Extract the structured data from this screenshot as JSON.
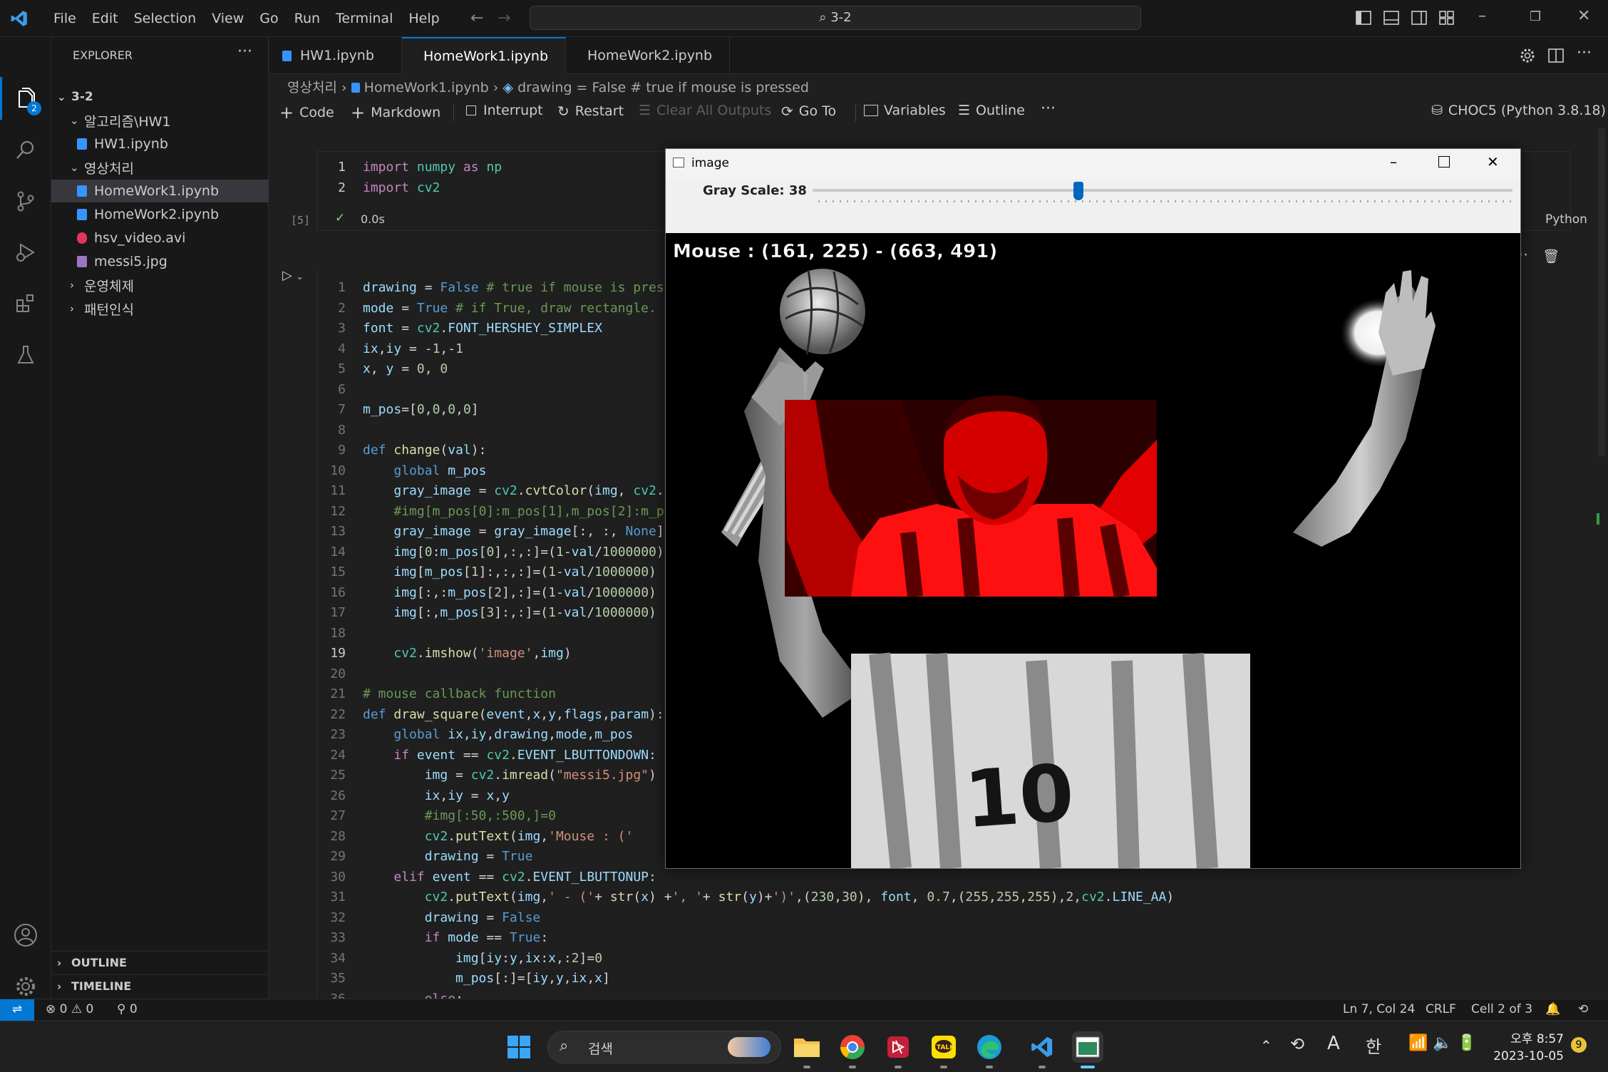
{
  "menu": [
    "File",
    "Edit",
    "Selection",
    "View",
    "Go",
    "Run",
    "Terminal",
    "Help"
  ],
  "search": {
    "text": "3-2"
  },
  "activity_badge": "2",
  "explorer": {
    "title": "EXPLORER",
    "root": "3-2",
    "items": [
      {
        "label": "알고리즘\\HW1",
        "type": "folder",
        "open": true
      },
      {
        "label": "HW1.ipynb",
        "type": "notebook"
      },
      {
        "label": "영상처리",
        "type": "folder",
        "open": true
      },
      {
        "label": "HomeWork1.ipynb",
        "type": "notebook",
        "selected": true
      },
      {
        "label": "HomeWork2.ipynb",
        "type": "notebook"
      },
      {
        "label": "hsv_video.avi",
        "type": "video"
      },
      {
        "label": "messi5.jpg",
        "type": "image"
      },
      {
        "label": "운영체제",
        "type": "folder",
        "open": false
      },
      {
        "label": "패턴인식",
        "type": "folder",
        "open": false
      }
    ],
    "outline": "OUTLINE",
    "timeline": "TIMELINE"
  },
  "tabs": [
    {
      "label": "HW1.ipynb",
      "active": false,
      "dirty": false
    },
    {
      "label": "HomeWork1.ipynb",
      "active": true,
      "dirty": true
    },
    {
      "label": "HomeWork2.ipynb",
      "active": false,
      "dirty": true
    }
  ],
  "breadcrumb": {
    "a": "영상처리",
    "b": "HomeWork1.ipynb",
    "c": "drawing = False # true if mouse is pressed"
  },
  "toolbar": {
    "code": "Code",
    "markdown": "Markdown",
    "interrupt": "Interrupt",
    "restart": "Restart",
    "clear": "Clear All Outputs",
    "goto": "Go To",
    "variables": "Variables",
    "outline": "Outline",
    "kernel": "CHOC5 (Python 3.8.18)"
  },
  "cell1": {
    "exec": "[5]",
    "time": "0.0s",
    "lang": "Python"
  },
  "image_window": {
    "title": "image",
    "trackbar_label": "Gray Scale: 38",
    "trackbar_value": 0.38,
    "overlay_text": "Mouse : (161, 225) - (663, 491)"
  },
  "status": {
    "errors": "0",
    "warnings": "0",
    "ports": "0",
    "position": "Ln 7, Col 24",
    "eol": "CRLF",
    "cell": "Cell 2 of 3"
  },
  "taskbar": {
    "search": "검색",
    "ime_a": "A",
    "ime_han": "한",
    "time": "오후 8:57",
    "date": "2023-10-05",
    "notif": "9"
  }
}
